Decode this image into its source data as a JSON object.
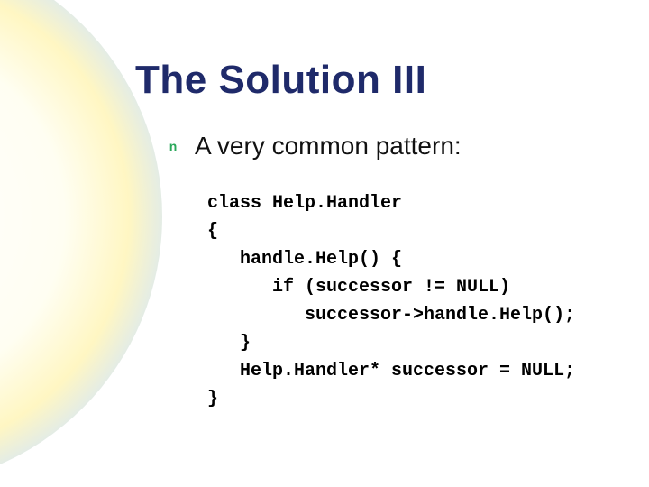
{
  "slide": {
    "title": "The Solution III",
    "bullet": {
      "glyph": "n",
      "text": "A very common pattern:"
    },
    "code": {
      "l1": "class Help.Handler",
      "l2": "{",
      "l3": "   handle.Help() {",
      "l4": "      if (successor != NULL)",
      "l5": "         successor->handle.Help();",
      "l6": "   }",
      "l7": "   Help.Handler* successor = NULL;",
      "l8": "}"
    }
  }
}
